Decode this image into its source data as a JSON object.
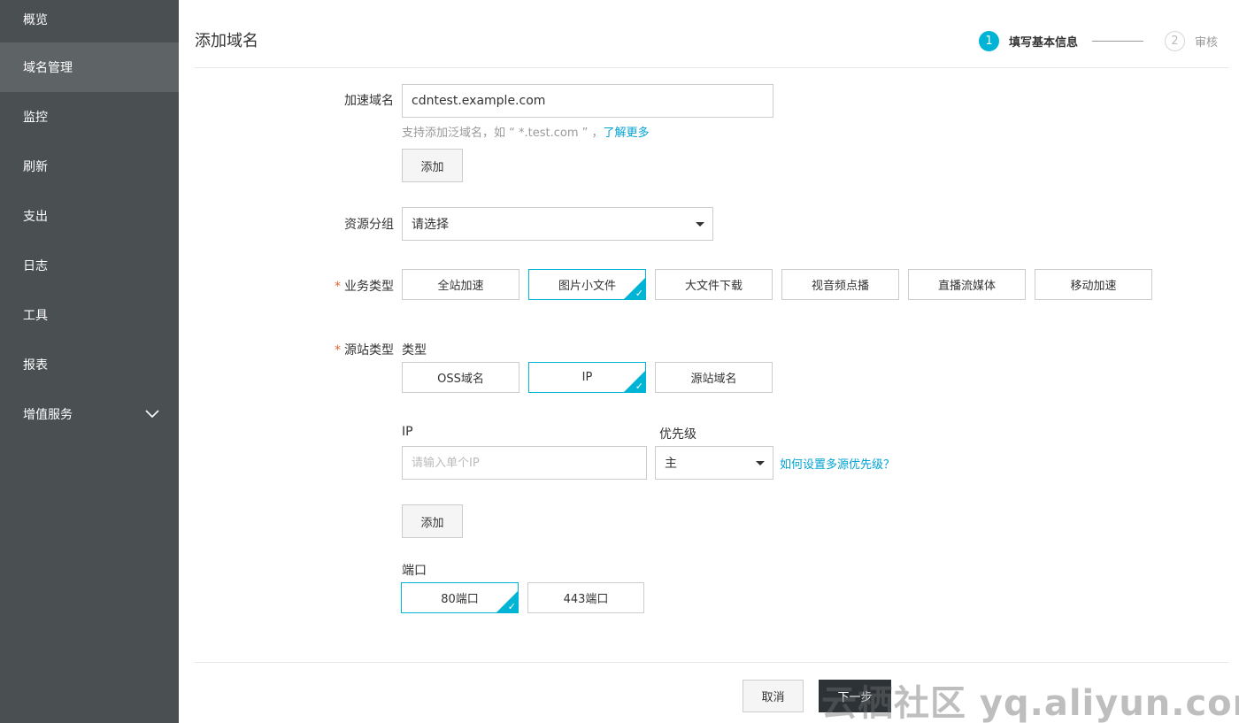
{
  "sidebar": {
    "items": [
      {
        "label": "概览"
      },
      {
        "label": "域名管理"
      },
      {
        "label": "监控"
      },
      {
        "label": "刷新"
      },
      {
        "label": "支出"
      },
      {
        "label": "日志"
      },
      {
        "label": "工具"
      },
      {
        "label": "报表"
      },
      {
        "label": "增值服务"
      }
    ],
    "active_index": 1
  },
  "header": {
    "title": "添加域名",
    "steps": [
      {
        "num": "1",
        "label": "填写基本信息"
      },
      {
        "num": "2",
        "label": "审核"
      }
    ]
  },
  "form": {
    "domain": {
      "label": "加速域名",
      "value": "cdntest.example.com",
      "hint_prefix": "支持添加泛域名，如 “ *.test.com ” ，",
      "hint_link": "了解更多",
      "add_label": "添加"
    },
    "resource_group": {
      "label": "资源分组",
      "value": "请选择"
    },
    "business_type": {
      "required_mark": "*",
      "label": "业务类型",
      "options": [
        "全站加速",
        "图片小文件",
        "大文件下载",
        "视音频点播",
        "直播流媒体",
        "移动加速"
      ],
      "selected": "图片小文件"
    },
    "origin_type": {
      "required_mark": "*",
      "label": "源站类型",
      "type_label": "类型",
      "options": [
        "OSS域名",
        "IP",
        "源站域名"
      ],
      "selected": "IP",
      "ip_label": "IP",
      "ip_placeholder": "请输入单个IP",
      "priority_label": "优先级",
      "priority_value": "主",
      "priority_link": "如何设置多源优先级？",
      "add_label": "添加",
      "port_label": "端口",
      "ports": [
        "80端口",
        "443端口"
      ],
      "port_selected": "80端口"
    }
  },
  "footer": {
    "cancel_label": "取消",
    "next_label": "下一步"
  },
  "watermark": "云栖社区 yq.aliyun.com",
  "colors": {
    "accent": "#00b4d6",
    "sidebar_bg": "#4a4f52",
    "sidebar_active": "#5e6366",
    "link": "#00a2d4",
    "required": "#e8622d"
  }
}
